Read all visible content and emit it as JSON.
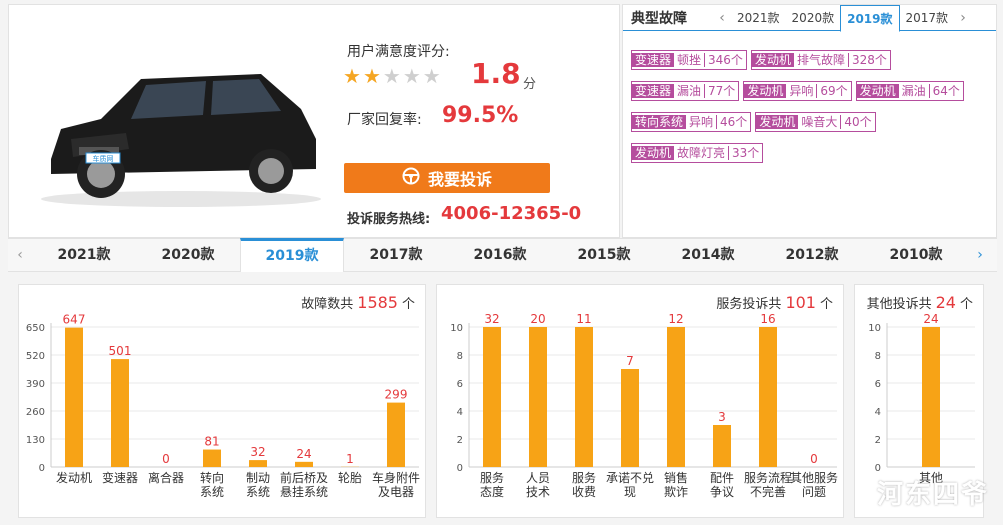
{
  "product": {
    "rating_label": "用户满意度评分:",
    "rating_score": "1.8",
    "rating_unit": "分",
    "stars_filled": 2,
    "stars_total": 5,
    "reply_label": "厂家回复率:",
    "reply_rate": "99.5%",
    "complain_button": "我要投诉",
    "hotline_label": "投诉服务热线:",
    "hotline_value": "4006-12365-0",
    "car_badge_text": "车质网"
  },
  "typical_faults": {
    "title": "典型故障",
    "tabs": [
      "2021款",
      "2020款",
      "2019款",
      "2017款"
    ],
    "active_tab": "2019款",
    "tags": [
      {
        "component": "变速器",
        "desc": "顿挫",
        "count": "346个"
      },
      {
        "component": "发动机",
        "desc": "排气故障",
        "count": "328个"
      },
      {
        "component": "变速器",
        "desc": "漏油",
        "count": "77个"
      },
      {
        "component": "发动机",
        "desc": "异响",
        "count": "69个"
      },
      {
        "component": "发动机",
        "desc": "漏油",
        "count": "64个"
      },
      {
        "component": "转向系统",
        "desc": "异响",
        "count": "46个"
      },
      {
        "component": "发动机",
        "desc": "噪音大",
        "count": "40个"
      },
      {
        "component": "发动机",
        "desc": "故障灯亮",
        "count": "33个"
      }
    ],
    "accent_color": "#b54d9d"
  },
  "year_tabs": {
    "items": [
      "2021款",
      "2020款",
      "2019款",
      "2017款",
      "2016款",
      "2015款",
      "2014款",
      "2012款",
      "2010款"
    ],
    "active": "2019款"
  },
  "panels": {
    "fault": {
      "label": "故障数共",
      "total": "1585",
      "unit": "个"
    },
    "service": {
      "label": "服务投诉共",
      "total": "101",
      "unit": "个"
    },
    "other": {
      "label": "其他投诉共",
      "total": "24",
      "unit": "个"
    }
  },
  "watermark": "河东四爷",
  "chart_data": [
    {
      "type": "bar",
      "categories": [
        "发动机",
        "变速器",
        "离合器",
        "转向\n系统",
        "制动\n系统",
        "前后桥及\n悬挂系统",
        "轮胎",
        "车身附件\n及电器"
      ],
      "values": [
        647,
        501,
        0,
        81,
        32,
        24,
        1,
        299
      ],
      "yticks": [
        0,
        130,
        260,
        390,
        520,
        650
      ],
      "ylim": [
        0,
        650
      ],
      "color": "#f7a316"
    },
    {
      "type": "bar",
      "categories": [
        "服务\n态度",
        "人员\n技术",
        "服务\n收费",
        "承诺不兑\n现",
        "销售\n欺诈",
        "配件\n争议",
        "服务流程\n不完善",
        "其他服务\n问题"
      ],
      "values": [
        32,
        20,
        11,
        7,
        12,
        3,
        16,
        0
      ],
      "yticks": [
        0,
        2,
        4,
        6,
        8,
        10
      ],
      "ylim": [
        0,
        10
      ],
      "color": "#f7a316"
    },
    {
      "type": "bar",
      "categories": [
        "其他"
      ],
      "values": [
        24
      ],
      "yticks": [
        0,
        2,
        4,
        6,
        8,
        10
      ],
      "ylim": [
        0,
        10
      ],
      "color": "#f7a316"
    }
  ]
}
